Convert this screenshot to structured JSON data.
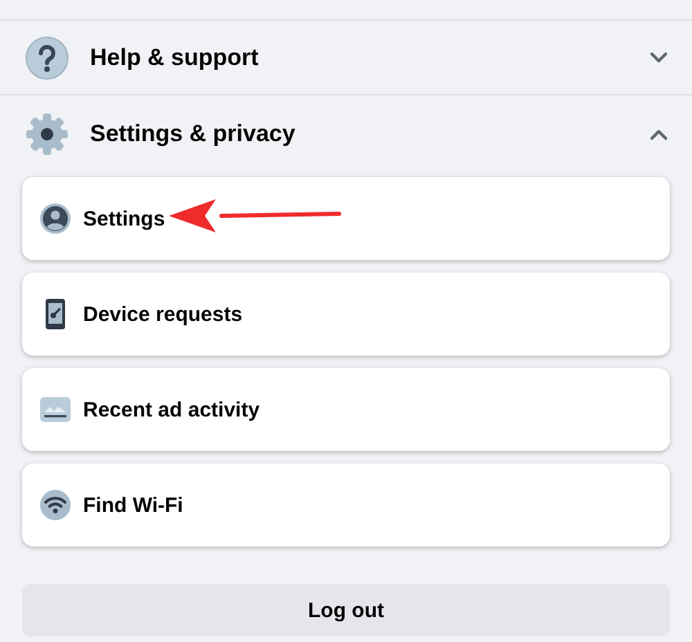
{
  "sections": [
    {
      "label": "Help & support",
      "expanded": false
    },
    {
      "label": "Settings & privacy",
      "expanded": true,
      "items": [
        {
          "label": "Settings"
        },
        {
          "label": "Device requests"
        },
        {
          "label": "Recent ad activity"
        },
        {
          "label": "Find Wi-Fi"
        }
      ]
    }
  ],
  "logout_button": "Log out"
}
